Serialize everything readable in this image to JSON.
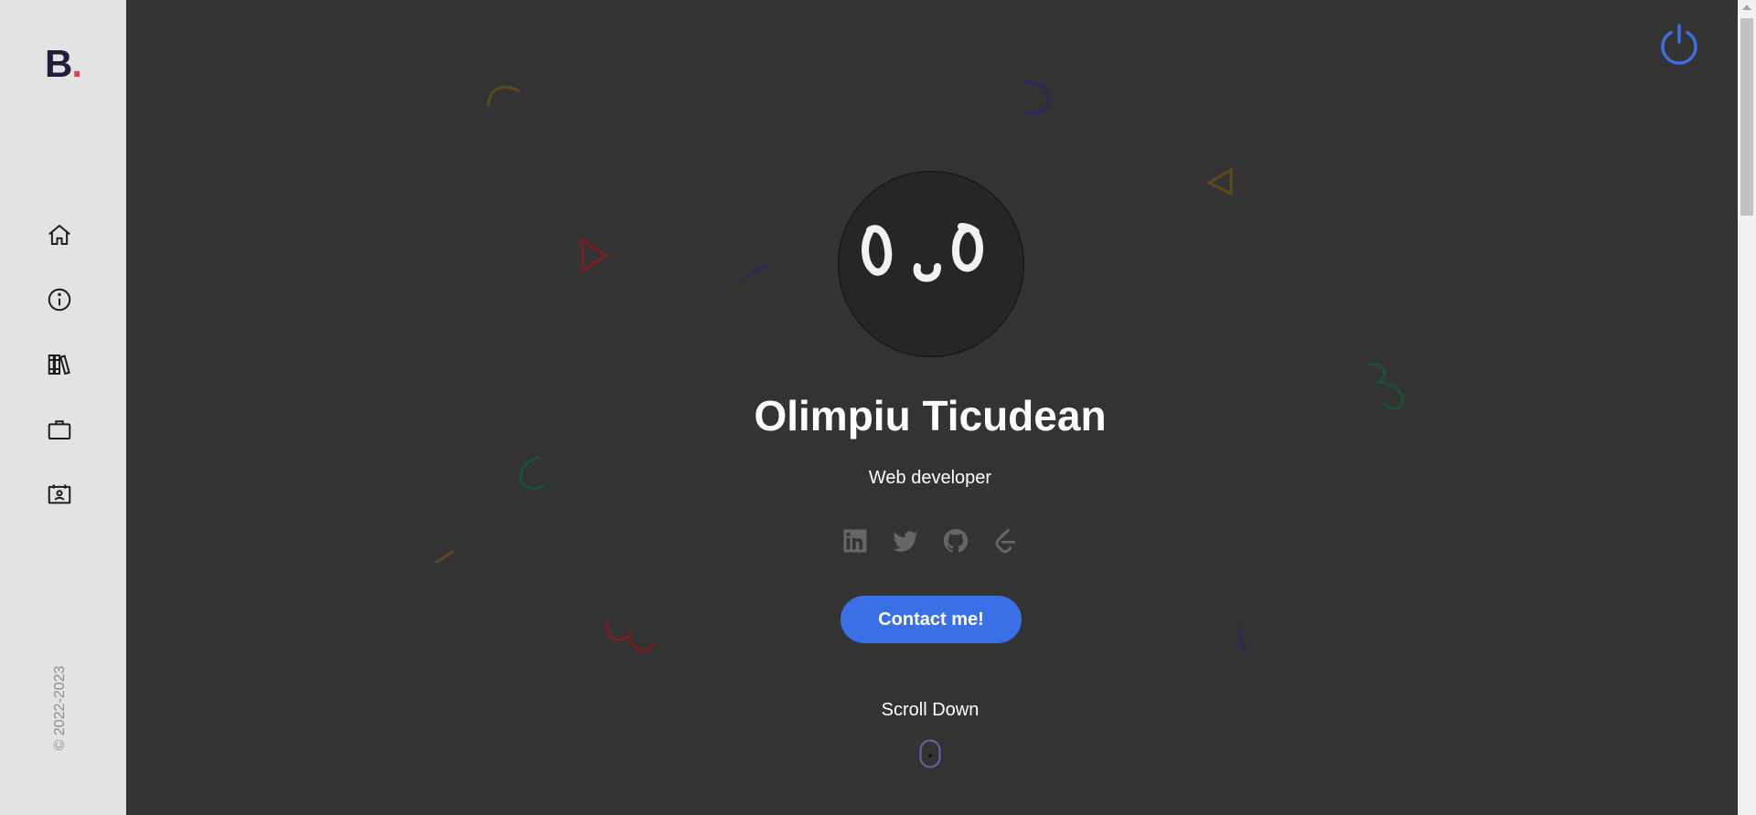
{
  "sidebar": {
    "logo_letter": "B",
    "logo_dot": ".",
    "nav": [
      {
        "icon": "home-icon"
      },
      {
        "icon": "info-icon"
      },
      {
        "icon": "books-icon"
      },
      {
        "icon": "briefcase-icon"
      },
      {
        "icon": "contact-card-icon"
      }
    ],
    "copyright": "© 2022-2023"
  },
  "header": {
    "power_icon": "power-icon"
  },
  "hero": {
    "avatar_icon": "face-avatar",
    "name": "Olimpiu Ticudean",
    "role": "Web developer",
    "social": [
      {
        "icon": "linkedin-icon"
      },
      {
        "icon": "twitter-icon"
      },
      {
        "icon": "github-icon"
      },
      {
        "icon": "leetcode-icon"
      }
    ],
    "contact_label": "Contact me!",
    "scroll_label": "Scroll Down",
    "scroll_icon": "mouse-icon"
  },
  "colors": {
    "background": "#333333",
    "sidebar_bg": "#e3e3e3",
    "accent": "#3b6fe6",
    "logo_dot": "#e5414f",
    "logo": "#221d3a"
  }
}
